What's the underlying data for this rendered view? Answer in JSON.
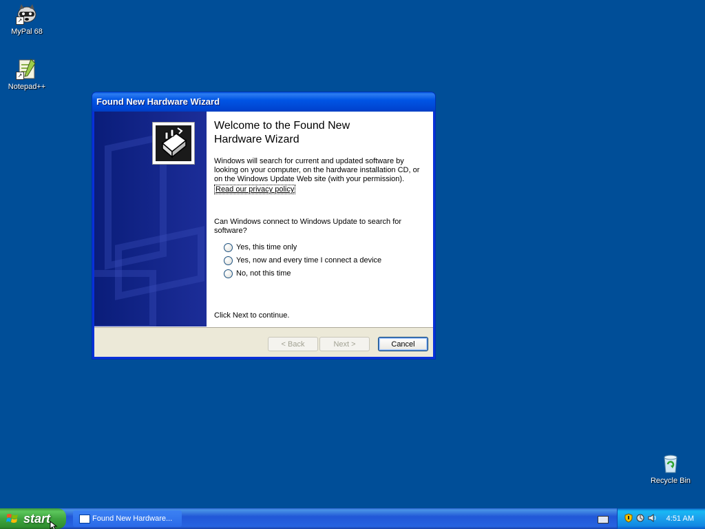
{
  "desktop": {
    "icons": [
      {
        "label": "MyPal 68"
      },
      {
        "label": "Notepad++"
      },
      {
        "label": "Recycle Bin"
      }
    ],
    "background_color": "#004e98"
  },
  "window": {
    "title": "Found New Hardware Wizard",
    "heading": "Welcome to the Found New Hardware Wizard",
    "intro": "Windows will search for current and updated software by looking on your computer, on the hardware installation CD, or on the Windows Update Web site (with your permission).",
    "privacy_link": "Read our privacy policy",
    "question": "Can Windows connect to Windows Update to search for software?",
    "options": [
      {
        "label": "Yes, this time only",
        "selected": false
      },
      {
        "label": "Yes, now and every time I connect a device",
        "selected": false
      },
      {
        "label": "No, not this time",
        "selected": false
      }
    ],
    "continue_text": "Click Next to continue.",
    "buttons": {
      "back": "< Back",
      "next": "Next >",
      "cancel": "Cancel"
    }
  },
  "taskbar": {
    "start_label": "start",
    "task_button_label": "Found New Hardware...",
    "clock": "4:51 AM",
    "tray_icons": [
      "keyboard-icon",
      "security-shield-icon",
      "network-icon",
      "volume-icon"
    ]
  },
  "colors": {
    "title_bar": "#0055e5",
    "taskbar": "#245edb",
    "start_button": "#3fa53f",
    "tray": "#1da5ee"
  }
}
